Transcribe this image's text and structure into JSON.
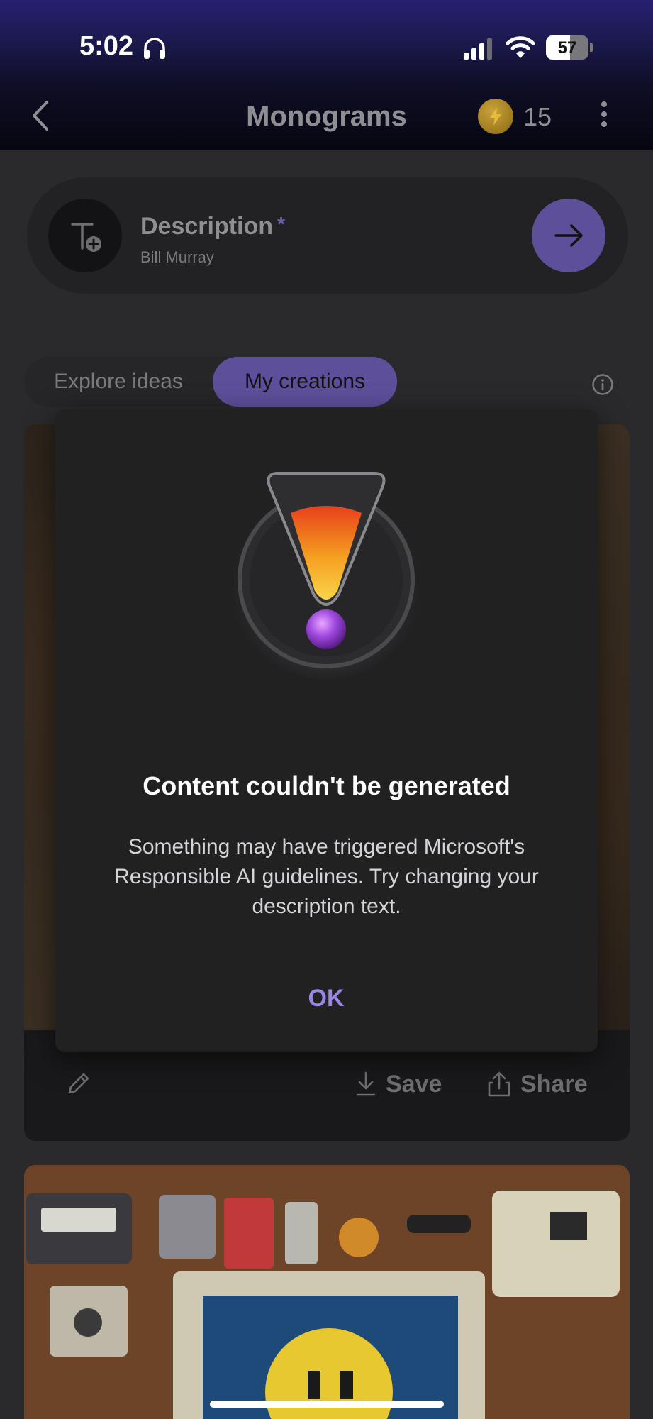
{
  "status_bar": {
    "time": "5:02",
    "battery_percent": "57",
    "icons": [
      "headphones-icon",
      "cellular-signal-icon",
      "wifi-icon",
      "battery-icon"
    ]
  },
  "app_bar": {
    "title": "Monograms",
    "coin_count": "15",
    "icons": [
      "back-chevron-icon",
      "coin-bolt-icon",
      "more-vertical-icon"
    ]
  },
  "description_card": {
    "label": "Description",
    "required_marker": "*",
    "value": "Bill Murray",
    "icons": [
      "text-add-icon",
      "arrow-right-icon"
    ]
  },
  "tabs": [
    {
      "label": "Explore ideas",
      "selected": false
    },
    {
      "label": "My creations",
      "selected": true
    }
  ],
  "card_actions": {
    "save_label": "Save",
    "share_label": "Share",
    "icons": [
      "pencil-edit-icon",
      "download-icon",
      "share-icon"
    ]
  },
  "dialog": {
    "title": "Content couldn't be generated",
    "message": "Something may have triggered Microsoft's Responsible AI guidelines. Try changing your description text.",
    "ok_label": "OK",
    "illustration": "warning-exclamation-illustration"
  },
  "colors": {
    "accent": "#5d4f9a",
    "ok_button": "#9b86e8",
    "dialog_bg": "#212122",
    "page_bg": "#2a2a2c"
  }
}
